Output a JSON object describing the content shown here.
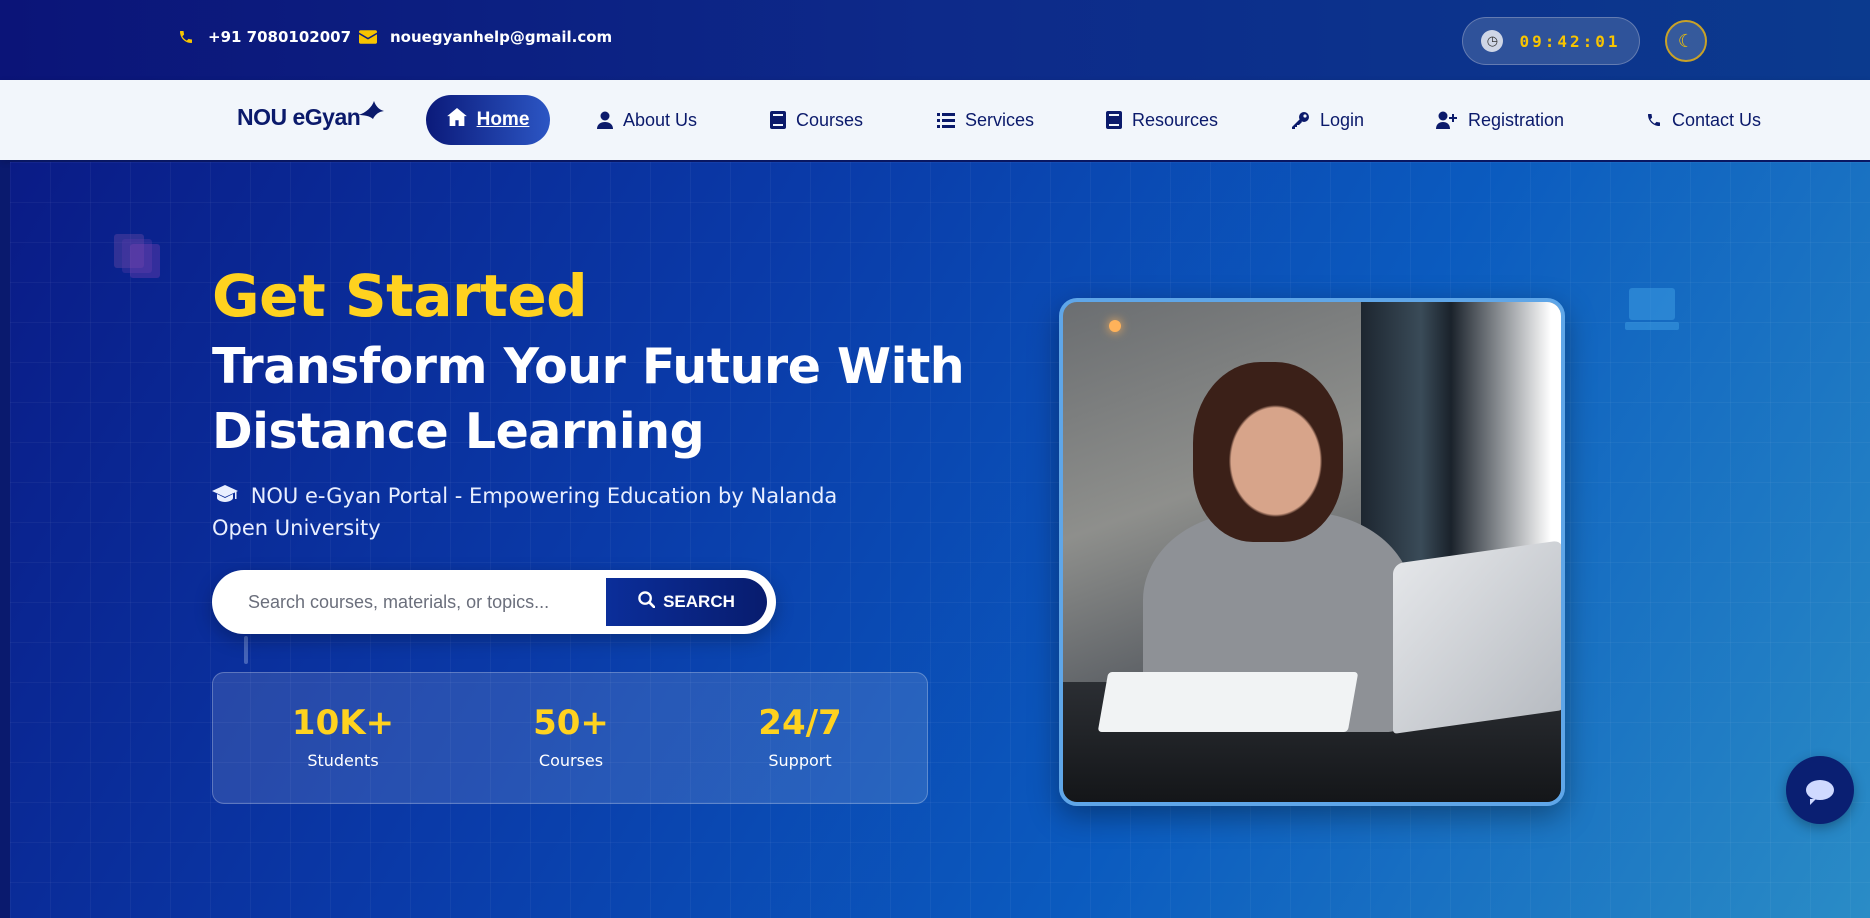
{
  "topbar": {
    "phone": "+91 7080102007",
    "email": "nouegyanhelp@gmail.com",
    "clock_time": "09:42:01",
    "icons": {
      "phone": "phone-icon",
      "email": "envelope-icon",
      "clock": "clock-icon",
      "theme": "moon-icon"
    }
  },
  "navbar": {
    "logo": "NOU eGyan",
    "items": [
      {
        "label": "Home",
        "icon": "home-icon",
        "active": true
      },
      {
        "label": "About Us",
        "icon": "user-icon"
      },
      {
        "label": "Courses",
        "icon": "book-icon"
      },
      {
        "label": "Services",
        "icon": "list-icon"
      },
      {
        "label": "Resources",
        "icon": "book-icon"
      },
      {
        "label": "Login",
        "icon": "key-icon"
      },
      {
        "label": "Registration",
        "icon": "user-plus-icon"
      },
      {
        "label": "Contact Us",
        "icon": "phone-icon"
      }
    ]
  },
  "hero": {
    "kicker": "Get Started",
    "headline": "Transform Your Future With Distance Learning",
    "tagline": "NOU e-Gyan Portal - Empowering Education by Nalanda Open University",
    "search": {
      "placeholder": "Search courses, materials, or topics...",
      "button": "SEARCH"
    },
    "stats": [
      {
        "value": "10K+",
        "label": "Students"
      },
      {
        "value": "50+",
        "label": "Courses"
      },
      {
        "value": "24/7",
        "label": "Support"
      }
    ]
  },
  "colors": {
    "accent": "#ffd21f",
    "primary": "#0b1a6b"
  }
}
